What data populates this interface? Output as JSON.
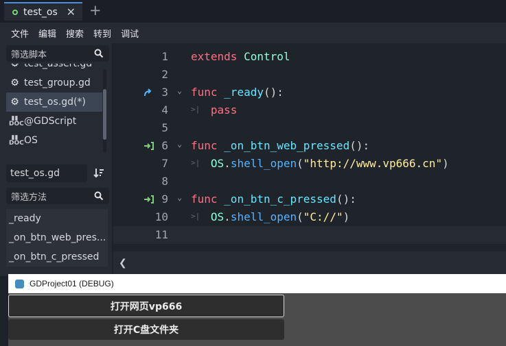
{
  "tabs": {
    "active_label": "test_os",
    "close_glyph": "✕",
    "add_glyph": "+"
  },
  "menu": [
    "文件",
    "编辑",
    "搜索",
    "转到",
    "调试"
  ],
  "script_panel": {
    "filter_placeholder": "筛选脚本",
    "scripts": [
      {
        "label": "test_assert.gd",
        "icon": "gear-icon"
      },
      {
        "label": "test_group.gd",
        "icon": "gear-icon"
      },
      {
        "label": "test_os.gd(*)",
        "icon": "gear-icon",
        "selected": true
      },
      {
        "label": "@GDScript",
        "icon": "doc-icon"
      },
      {
        "label": "OS",
        "icon": "doc-icon"
      }
    ],
    "current_file": "test_os.gd",
    "method_filter_placeholder": "筛选方法",
    "methods": [
      "_ready",
      "_on_btn_web_pres...",
      "_on_btn_c_pressed"
    ]
  },
  "editor": {
    "line_numbers": [
      "1",
      "2",
      "3",
      "4",
      "5",
      "6",
      "7",
      "8",
      "9",
      "10",
      "11"
    ],
    "lines": {
      "l1_kw": "extends",
      "l1_type": "Control",
      "l3_kw": "func",
      "l3_fn": "_ready",
      "l3_rest": "():",
      "l4_kw": "pass",
      "l6_kw": "func",
      "l6_fn": "_on_btn_web_pressed",
      "l6_rest": "():",
      "l7_obj": "OS",
      "l7_dot": ".",
      "l7_mth": "shell_open",
      "l7_open": "(",
      "l7_str": "\"http://www.vp666.cn\"",
      "l7_close": ")",
      "l9_kw": "func",
      "l9_fn": "_on_btn_c_pressed",
      "l9_rest": "():",
      "l10_obj": "OS",
      "l10_dot": ".",
      "l10_mth": "shell_open",
      "l10_open": "(",
      "l10_str": "\"C://\"",
      "l10_close": ")"
    }
  },
  "debug_window": {
    "title": "GDProject01 (DEBUG)",
    "btn_web": "打开网页vp666",
    "btn_c": "打开C盘文件夹"
  },
  "colors": {
    "accent": "#4a8ee6",
    "keyword": "#ff7085",
    "function": "#66e6ff",
    "string": "#ffeda1",
    "type": "#8fffdb"
  }
}
